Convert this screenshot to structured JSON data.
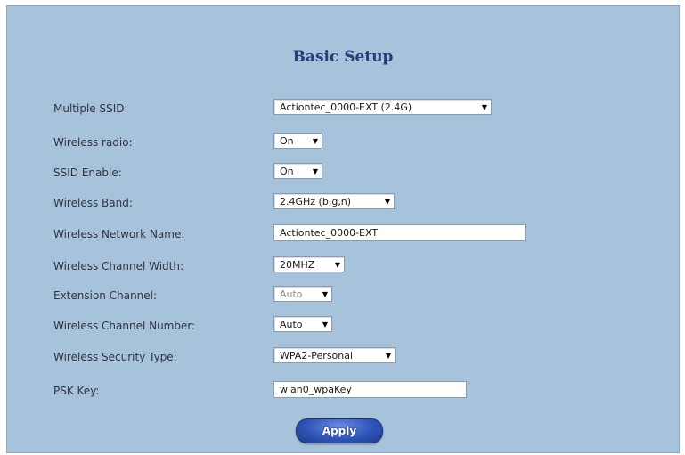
{
  "page": {
    "title": "Basic Setup"
  },
  "form": {
    "multiple_ssid": {
      "label": "Multiple SSID:",
      "value": "Actiontec_0000-EXT (2.4G)"
    },
    "wireless_radio": {
      "label": "Wireless radio:",
      "value": "On"
    },
    "ssid_enable": {
      "label": "SSID Enable:",
      "value": "On"
    },
    "wireless_band": {
      "label": "Wireless Band:",
      "value": "2.4GHz (b,g,n)"
    },
    "network_name": {
      "label": "Wireless Network Name:",
      "value": "Actiontec_0000-EXT"
    },
    "channel_width": {
      "label": "Wireless Channel Width:",
      "value": "20MHZ"
    },
    "extension_channel": {
      "label": "Extension Channel:",
      "value": "Auto"
    },
    "channel_number": {
      "label": "Wireless Channel Number:",
      "value": "Auto"
    },
    "security_type": {
      "label": "Wireless Security Type:",
      "value": "WPA2-Personal"
    },
    "psk_key": {
      "label": "PSK Key:",
      "value": "wlan0_wpaKey"
    }
  },
  "actions": {
    "apply_label": "Apply"
  },
  "icons": {
    "dropdown": "dropdown-arrow-icon"
  },
  "colors": {
    "panel_bg": "#a7c3dc",
    "title": "#243f7a",
    "button": "#2f55b8"
  }
}
